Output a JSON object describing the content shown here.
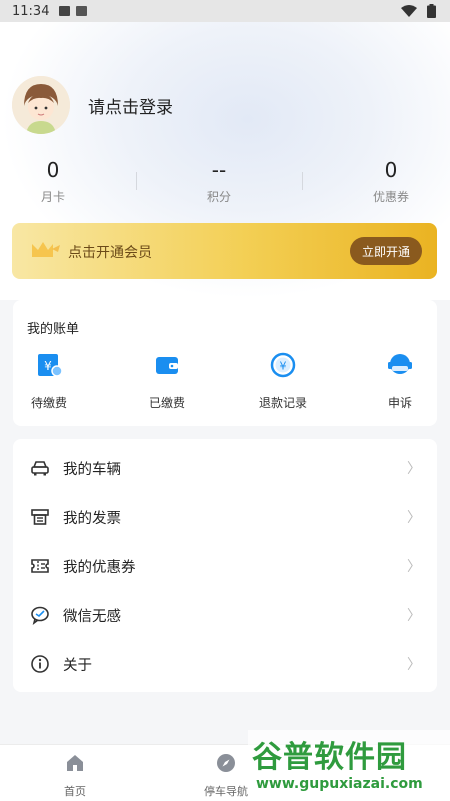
{
  "statusbar": {
    "time": "11:34"
  },
  "profile": {
    "login_text": "请点击登录"
  },
  "stats": [
    {
      "value": "0",
      "label": "月卡"
    },
    {
      "value": "--",
      "label": "积分"
    },
    {
      "value": "0",
      "label": "优惠券"
    }
  ],
  "vip": {
    "text": "点击开通会员",
    "button": "立即开通"
  },
  "bill": {
    "title": "我的账单",
    "items": [
      {
        "label": "待缴费",
        "icon": "pending-payment-icon"
      },
      {
        "label": "已缴费",
        "icon": "wallet-icon"
      },
      {
        "label": "退款记录",
        "icon": "refund-icon"
      },
      {
        "label": "申诉",
        "icon": "support-icon"
      }
    ]
  },
  "menu": [
    {
      "label": "我的车辆",
      "icon": "car-icon"
    },
    {
      "label": "我的发票",
      "icon": "invoice-icon"
    },
    {
      "label": "我的优惠券",
      "icon": "coupon-icon"
    },
    {
      "label": "微信无感",
      "icon": "wechat-icon"
    },
    {
      "label": "关于",
      "icon": "info-icon"
    }
  ],
  "tabbar": [
    {
      "label": "首页",
      "icon": "home-icon"
    },
    {
      "label": "停车导航",
      "icon": "compass-icon"
    }
  ],
  "watermark": {
    "line1": "谷普软件园",
    "line2": "www.gupuxiazai.com"
  },
  "colors": {
    "accent_blue": "#1a8ef0",
    "vip_gold": "#f3cf54",
    "vip_button": "#8a5a1e"
  }
}
